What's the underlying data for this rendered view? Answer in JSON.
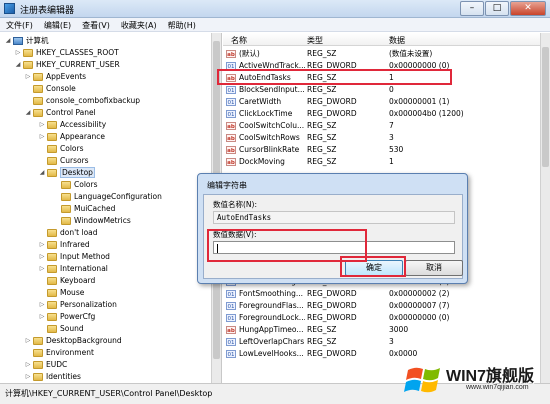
{
  "window": {
    "title": "注册表编辑器",
    "min": "–",
    "max": "□",
    "close": "✕"
  },
  "menu": [
    "文件(F)",
    "编辑(E)",
    "查看(V)",
    "收藏夹(A)",
    "帮助(H)"
  ],
  "tree": [
    {
      "label": "计算机",
      "depth": 0,
      "toggle": "◢",
      "icon": "pc"
    },
    {
      "label": "HKEY_CLASSES_ROOT",
      "depth": 1,
      "toggle": "▷",
      "icon": "folder"
    },
    {
      "label": "HKEY_CURRENT_USER",
      "depth": 1,
      "toggle": "◢",
      "icon": "folder"
    },
    {
      "label": "AppEvents",
      "depth": 2,
      "toggle": "▷",
      "icon": "folder"
    },
    {
      "label": "Console",
      "depth": 2,
      "toggle": "",
      "icon": "folder"
    },
    {
      "label": "console_combofixbackup",
      "depth": 2,
      "toggle": "",
      "icon": "folder"
    },
    {
      "label": "Control Panel",
      "depth": 2,
      "toggle": "◢",
      "icon": "folder"
    },
    {
      "label": "Accessibility",
      "depth": 3,
      "toggle": "▷",
      "icon": "folder"
    },
    {
      "label": "Appearance",
      "depth": 3,
      "toggle": "▷",
      "icon": "folder"
    },
    {
      "label": "Colors",
      "depth": 3,
      "toggle": "",
      "icon": "folder"
    },
    {
      "label": "Cursors",
      "depth": 3,
      "toggle": "",
      "icon": "folder"
    },
    {
      "label": "Desktop",
      "depth": 3,
      "toggle": "◢",
      "icon": "folder",
      "selected": true
    },
    {
      "label": "Colors",
      "depth": 4,
      "toggle": "",
      "icon": "folder"
    },
    {
      "label": "LanguageConfiguration",
      "depth": 4,
      "toggle": "",
      "icon": "folder"
    },
    {
      "label": "MuiCached",
      "depth": 4,
      "toggle": "",
      "icon": "folder"
    },
    {
      "label": "WindowMetrics",
      "depth": 4,
      "toggle": "",
      "icon": "folder"
    },
    {
      "label": "don't load",
      "depth": 3,
      "toggle": "",
      "icon": "folder"
    },
    {
      "label": "Infrared",
      "depth": 3,
      "toggle": "▷",
      "icon": "folder"
    },
    {
      "label": "Input Method",
      "depth": 3,
      "toggle": "▷",
      "icon": "folder"
    },
    {
      "label": "International",
      "depth": 3,
      "toggle": "▷",
      "icon": "folder"
    },
    {
      "label": "Keyboard",
      "depth": 3,
      "toggle": "",
      "icon": "folder"
    },
    {
      "label": "Mouse",
      "depth": 3,
      "toggle": "",
      "icon": "folder"
    },
    {
      "label": "Personalization",
      "depth": 3,
      "toggle": "▷",
      "icon": "folder"
    },
    {
      "label": "PowerCfg",
      "depth": 3,
      "toggle": "▷",
      "icon": "folder"
    },
    {
      "label": "Sound",
      "depth": 3,
      "toggle": "",
      "icon": "folder"
    },
    {
      "label": "DesktopBackground",
      "depth": 2,
      "toggle": "▷",
      "icon": "folder"
    },
    {
      "label": "Environment",
      "depth": 2,
      "toggle": "",
      "icon": "folder"
    },
    {
      "label": "EUDC",
      "depth": 2,
      "toggle": "▷",
      "icon": "folder"
    },
    {
      "label": "Identities",
      "depth": 2,
      "toggle": "▷",
      "icon": "folder"
    }
  ],
  "list": {
    "headers": {
      "name": "名称",
      "type": "类型",
      "data": "数据"
    },
    "rows": [
      {
        "icon": "sz",
        "name": "(默认)",
        "type": "REG_SZ",
        "data": "(数值未设置)"
      },
      {
        "icon": "bin",
        "name": "ActiveWndTrack...",
        "type": "REG_DWORD",
        "data": "0x00000000 (0)"
      },
      {
        "icon": "sz",
        "name": "AutoEndTasks",
        "type": "REG_SZ",
        "data": "1"
      },
      {
        "icon": "bin",
        "name": "BlockSendInput...",
        "type": "REG_SZ",
        "data": "0"
      },
      {
        "icon": "bin",
        "name": "CaretWidth",
        "type": "REG_DWORD",
        "data": "0x00000001 (1)"
      },
      {
        "icon": "bin",
        "name": "ClickLockTime",
        "type": "REG_DWORD",
        "data": "0x000004b0 (1200)"
      },
      {
        "icon": "sz",
        "name": "CoolSwitchColu...",
        "type": "REG_SZ",
        "data": "7"
      },
      {
        "icon": "sz",
        "name": "CoolSwitchRows",
        "type": "REG_SZ",
        "data": "3"
      },
      {
        "icon": "sz",
        "name": "CursorBlinkRate",
        "type": "REG_SZ",
        "data": "530"
      },
      {
        "icon": "sz",
        "name": "DockMoving",
        "type": "REG_SZ",
        "data": "1"
      },
      {
        "icon": "",
        "name": "",
        "type": "",
        "data": ""
      },
      {
        "icon": "",
        "name": "",
        "type": "",
        "data": ""
      },
      {
        "icon": "",
        "name": "",
        "type": "",
        "data": ""
      },
      {
        "icon": "",
        "name": "",
        "type": "",
        "data": ""
      },
      {
        "icon": "",
        "name": "",
        "type": "",
        "data": ""
      },
      {
        "icon": "",
        "name": "",
        "type": "",
        "data": ""
      },
      {
        "icon": "",
        "name": "",
        "type": "",
        "data": ""
      },
      {
        "icon": "",
        "name": "",
        "type": "",
        "data": ""
      },
      {
        "icon": "",
        "name": "",
        "type": "",
        "data": ""
      },
      {
        "icon": "bin",
        "name": "FontSmoothing...",
        "type": "REG_DWORD",
        "data": "0x00000001 (1)"
      },
      {
        "icon": "bin",
        "name": "FontSmoothing...",
        "type": "REG_DWORD",
        "data": "0x00000002 (2)"
      },
      {
        "icon": "bin",
        "name": "ForegroundFlas...",
        "type": "REG_DWORD",
        "data": "0x00000007 (7)"
      },
      {
        "icon": "bin",
        "name": "ForegroundLock...",
        "type": "REG_DWORD",
        "data": "0x00000000 (0)"
      },
      {
        "icon": "sz",
        "name": "HungAppTimeo...",
        "type": "REG_SZ",
        "data": "3000"
      },
      {
        "icon": "bin",
        "name": "LeftOverlapChars",
        "type": "REG_SZ",
        "data": "3"
      },
      {
        "icon": "bin",
        "name": "LowLevelHooks...",
        "type": "REG_DWORD",
        "data": "0x0000"
      }
    ]
  },
  "dialog": {
    "title": "编辑字符串",
    "name_label": "数值名称(N):",
    "name_value": "AutoEndTasks",
    "data_label": "数值数据(V):",
    "data_value": "",
    "ok": "确定",
    "cancel": "取消"
  },
  "statusbar": "计算机\\HKEY_CURRENT_USER\\Control Panel\\Desktop",
  "watermark": {
    "brand": "WIN7旗舰版",
    "url": "www.win7qijian.com"
  },
  "colors": {
    "highlight": "#e0283a",
    "titlebar": "#c3d6ee",
    "dialog_frame": "#cfe0f4"
  }
}
